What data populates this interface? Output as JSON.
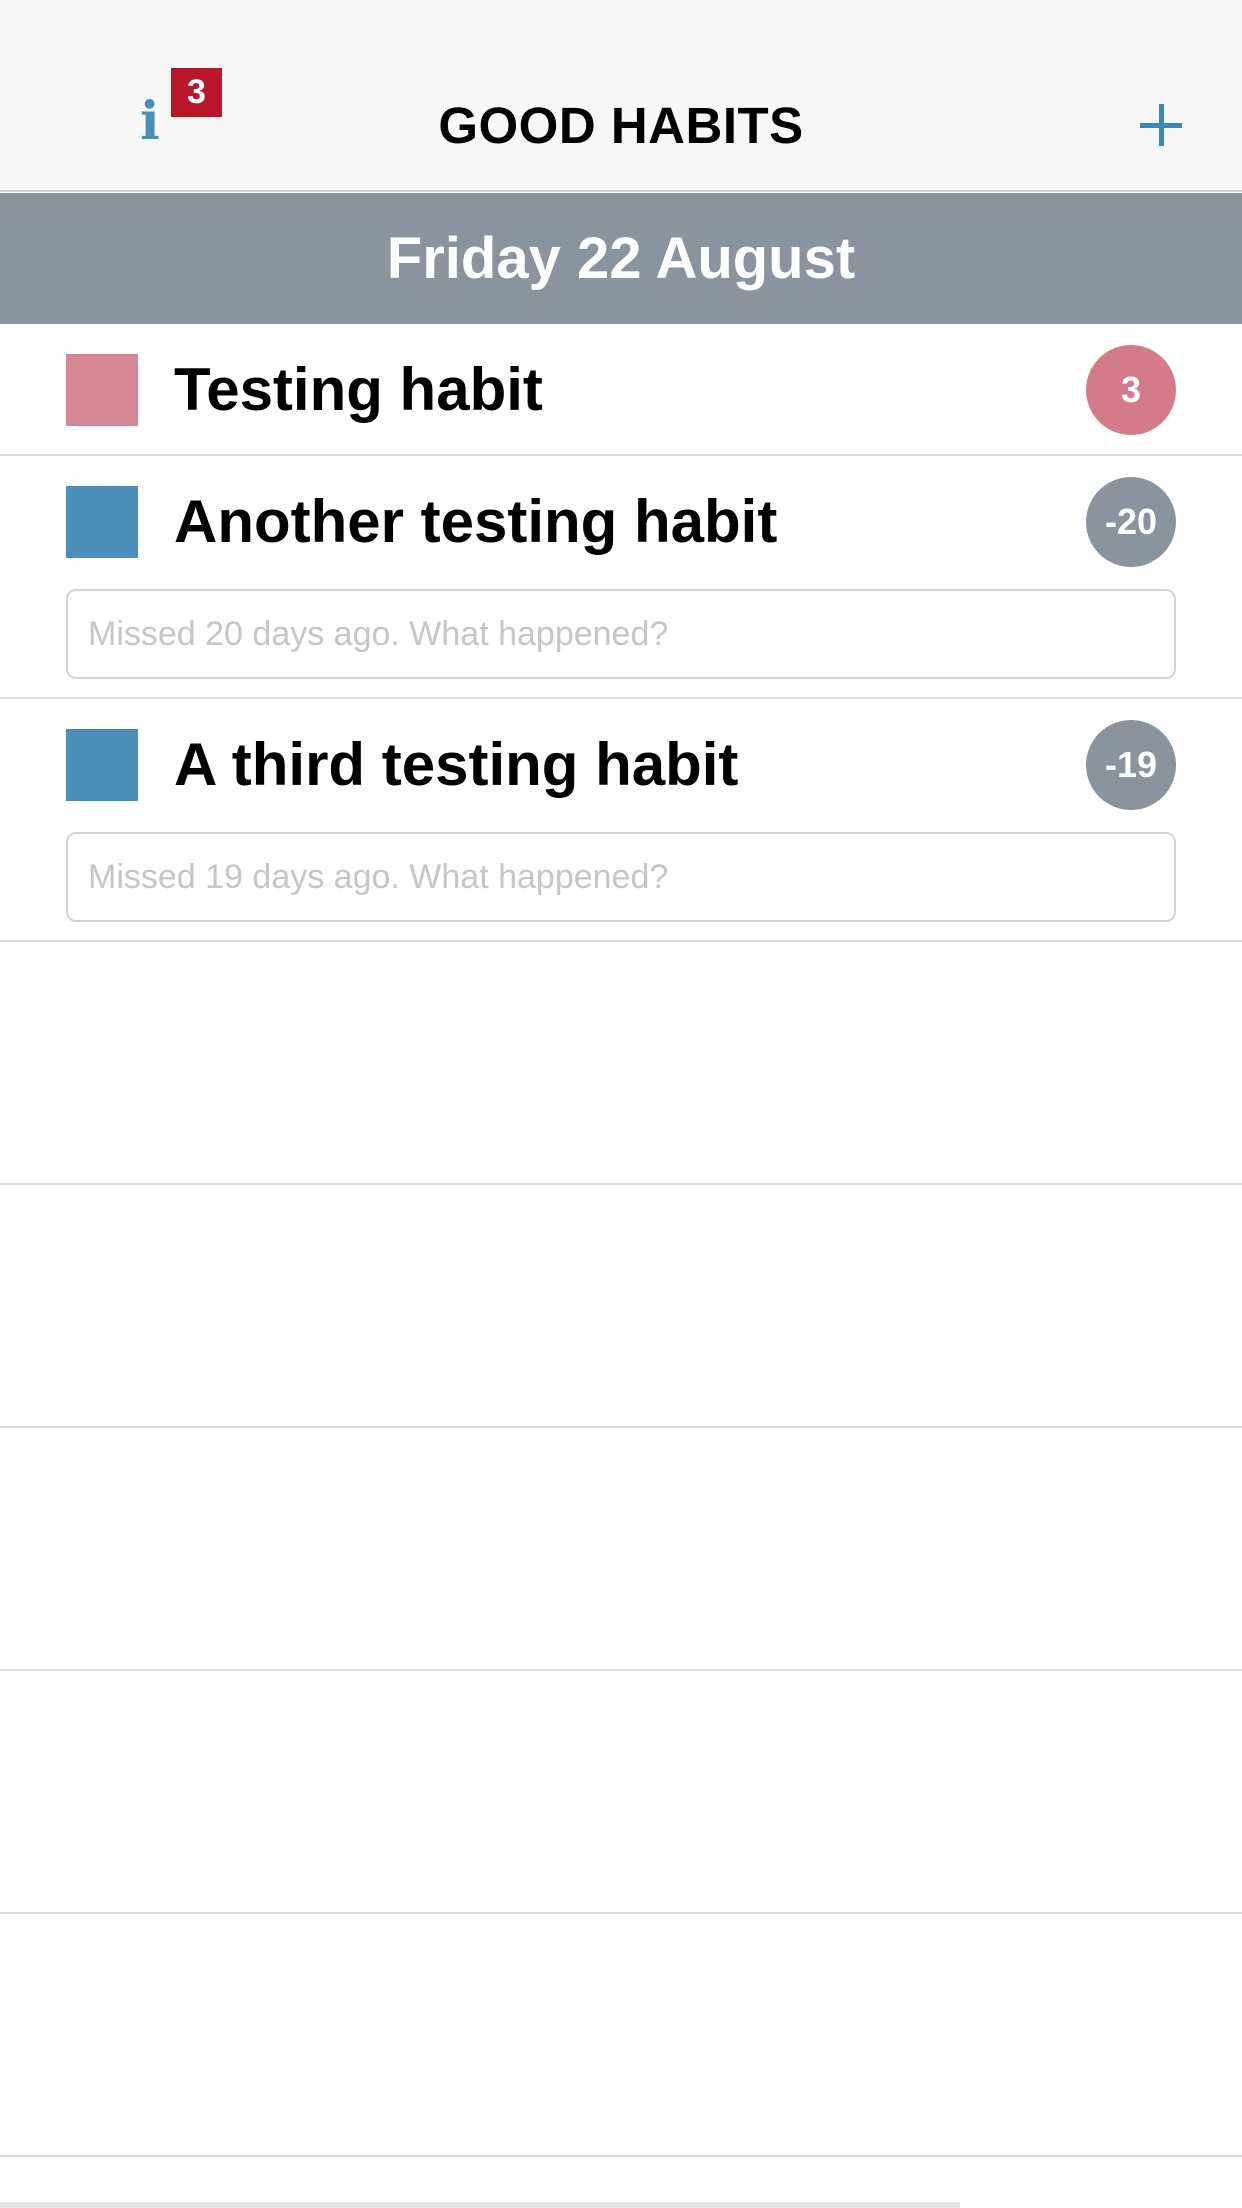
{
  "navbar": {
    "title": "GOOD HABITS",
    "info_glyph": "i",
    "info_badge": "3",
    "info_icon": "info-icon",
    "add_icon": "plus-icon"
  },
  "date_header": "Friday 22 August",
  "habits": [
    {
      "name": "Testing habit",
      "color": "#d58794",
      "streak": "3",
      "streak_color": "#d47b8a",
      "note_placeholder": ""
    },
    {
      "name": "Another testing habit",
      "color": "#4a8fb8",
      "streak": "-20",
      "streak_color": "#8a939e",
      "note_placeholder": "Missed 20 days ago. What happened?"
    },
    {
      "name": "A third testing habit",
      "color": "#4a8fb8",
      "streak": "-19",
      "streak_color": "#8a939e",
      "note_placeholder": "Missed 19 days ago. What happened?"
    }
  ],
  "colors": {
    "accent": "#3d86b5",
    "badge": "#b8162a",
    "banner": "#8a939e"
  }
}
